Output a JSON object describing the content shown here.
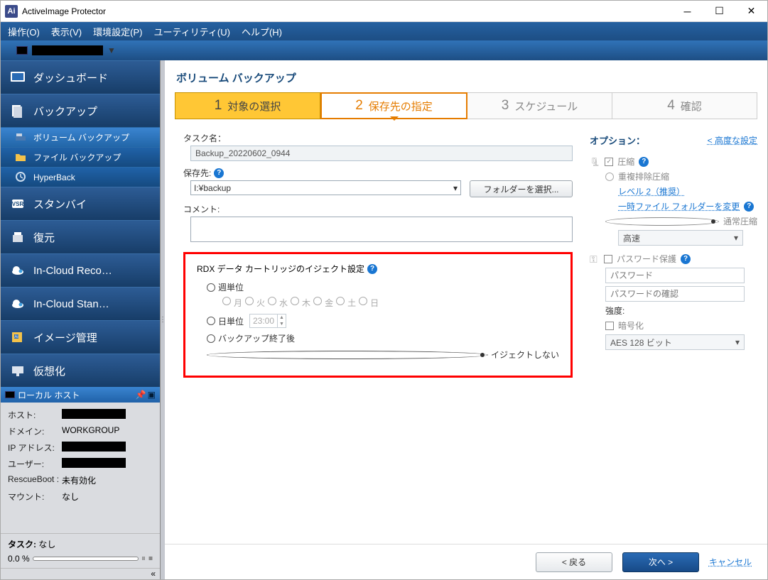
{
  "window": {
    "title": "ActiveImage Protector"
  },
  "menu": {
    "operation": "操作(O)",
    "view": "表示(V)",
    "env": "環境設定(P)",
    "utility": "ユーティリティ(U)",
    "help": "ヘルプ(H)"
  },
  "nav": {
    "dashboard": "ダッシュボード",
    "backup": "バックアップ",
    "volume_backup": "ボリューム バックアップ",
    "file_backup": "ファイル バックアップ",
    "hyperback": "HyperBack",
    "standby": "スタンバイ",
    "restore": "復元",
    "incloud_reco": "In-Cloud Reco…",
    "incloud_stan": "In-Cloud Stan…",
    "image_mgmt": "イメージ管理",
    "virtual": "仮想化"
  },
  "local": {
    "header": "ローカル ホスト",
    "host_label": "ホスト:",
    "domain_label": "ドメイン:",
    "domain_val": "WORKGROUP",
    "ip_label": "IP アドレス:",
    "user_label": "ユーザー:",
    "rescue_label": "RescueBoot :",
    "rescue_val": "未有効化",
    "mount_label": "マウント:",
    "mount_val": "なし",
    "task_label": "タスク:",
    "task_val": "なし",
    "percent": "0.0 %"
  },
  "page": {
    "title": "ボリューム バックアップ"
  },
  "wizard": {
    "s1_num": "1",
    "s1": "対象の選択",
    "s2_num": "2",
    "s2": "保存先の指定",
    "s3_num": "3",
    "s3": "スケジュール",
    "s4_num": "4",
    "s4": "確認"
  },
  "form": {
    "task_label": "タスク名：",
    "task_val": "Backup_20220602_0944",
    "dest_label": "保存先:",
    "dest_val": "I:¥backup",
    "browse_btn": "フォルダーを選択...",
    "comment_label": "コメント:"
  },
  "rdx": {
    "title": "RDX データ カートリッジのイジェクト設定",
    "weekly": "週単位",
    "d_mon": "月",
    "d_tue": "火",
    "d_wed": "水",
    "d_thu": "木",
    "d_fri": "金",
    "d_sat": "土",
    "d_sun": "日",
    "daily": "日単位",
    "daily_time": "23:00",
    "after_backup": "バックアップ終了後",
    "no_eject": "イジェクトしない"
  },
  "opt": {
    "header": "オプション：",
    "adv": "< 高度な設定",
    "compress": "圧縮",
    "dedupe": "重複排除圧縮",
    "level2": "レベル 2（推奨）",
    "temp_folder": "一時ファイル フォルダーを変更",
    "normal": "通常圧縮",
    "speed": "高速",
    "pwd_protect": "パスワード保護",
    "pwd_placeholder": "パスワード",
    "pwd_confirm_placeholder": "パスワードの確認",
    "strength": "強度:",
    "encrypt": "暗号化",
    "aes": "AES 128 ビット"
  },
  "footer": {
    "back": "< 戻る",
    "next": "次へ >",
    "cancel": "キャンセル"
  }
}
